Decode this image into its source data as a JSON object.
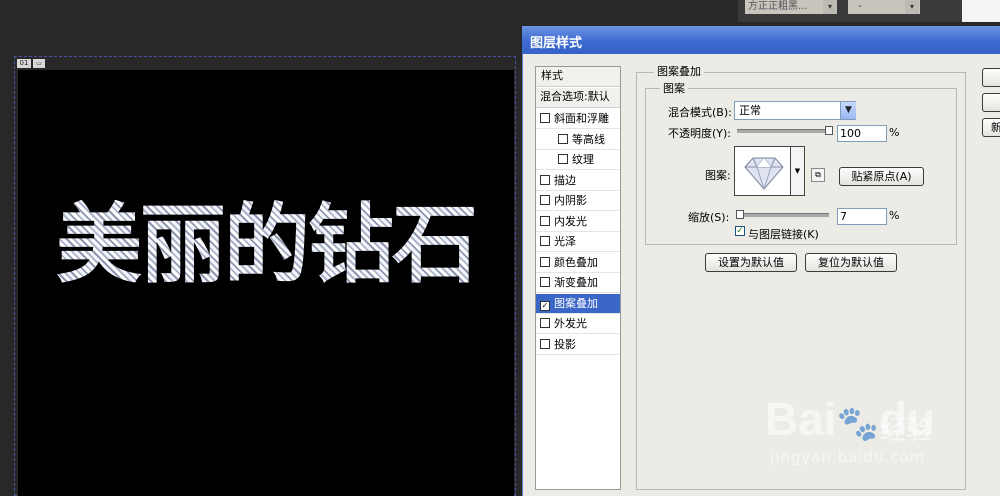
{
  "toolbar": {
    "font_family": "方正正粗黑...",
    "font_size": "-"
  },
  "canvas": {
    "tag": "01",
    "text": "美丽的钻石"
  },
  "dialog": {
    "title": "图层样式",
    "style_list": {
      "header": "样式",
      "blend_options": "混合选项:默认",
      "items": [
        {
          "label": "斜面和浮雕",
          "checked": false,
          "sub": false,
          "selected": false
        },
        {
          "label": "等高线",
          "checked": false,
          "sub": true,
          "selected": false
        },
        {
          "label": "纹理",
          "checked": false,
          "sub": true,
          "selected": false
        },
        {
          "label": "描边",
          "checked": false,
          "sub": false,
          "selected": false
        },
        {
          "label": "内阴影",
          "checked": false,
          "sub": false,
          "selected": false
        },
        {
          "label": "内发光",
          "checked": false,
          "sub": false,
          "selected": false
        },
        {
          "label": "光泽",
          "checked": false,
          "sub": false,
          "selected": false
        },
        {
          "label": "颜色叠加",
          "checked": false,
          "sub": false,
          "selected": false
        },
        {
          "label": "渐变叠加",
          "checked": false,
          "sub": false,
          "selected": false
        },
        {
          "label": "图案叠加",
          "checked": true,
          "sub": false,
          "selected": true
        },
        {
          "label": "外发光",
          "checked": false,
          "sub": false,
          "selected": false
        },
        {
          "label": "投影",
          "checked": false,
          "sub": false,
          "selected": false
        }
      ]
    },
    "pattern_overlay": {
      "section_title": "图案叠加",
      "group_title": "图案",
      "blend_mode_label": "混合模式(B):",
      "blend_mode_value": "正常",
      "opacity_label": "不透明度(Y):",
      "opacity_value": "100",
      "opacity_unit": "%",
      "opacity_level": 1.0,
      "pattern_label": "图案:",
      "snap_origin_button": "贴紧原点(A)",
      "scale_label": "缩放(S):",
      "scale_value": "7",
      "scale_unit": "%",
      "scale_level": 0.0,
      "link_layer_label": "与图层链接(K)",
      "link_layer_checked": true,
      "make_default_button": "设置为默认值",
      "reset_default_button": "复位为默认值"
    },
    "side_buttons": [
      "",
      "",
      "新"
    ]
  },
  "watermark": {
    "brand": "Bai",
    "brand2": "du",
    "jingyan": "经验",
    "url": "jingyan.baidu.com"
  }
}
